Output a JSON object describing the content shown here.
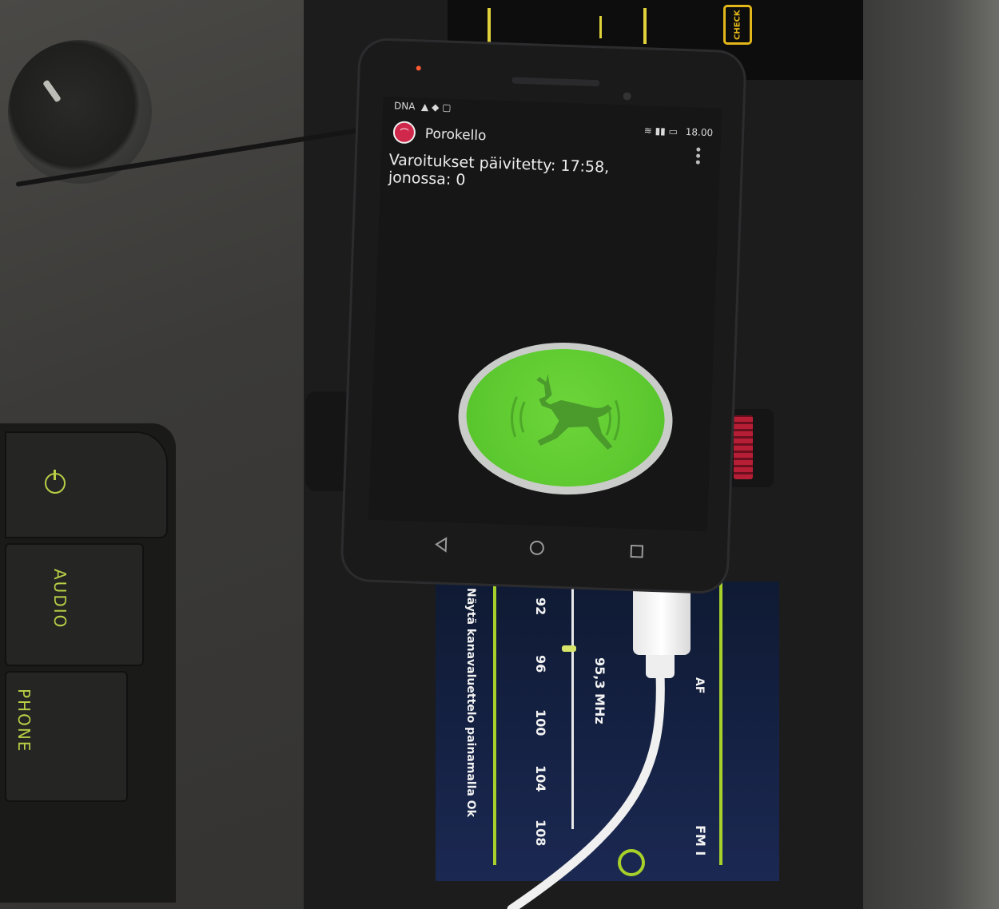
{
  "phone": {
    "status": {
      "carrier": "DNA",
      "clock": "18.00"
    },
    "app": {
      "title": "Porokello",
      "message_line1": "Varoitukset päivitetty: 17:58,",
      "message_line2": "jonossa: 0"
    },
    "alert_button": {
      "color": "#5ccb30",
      "icon": "reindeer-icon"
    },
    "nav": {
      "back": "◁",
      "home": "○",
      "recent": "□"
    }
  },
  "dashboard": {
    "check_label": "CHECK",
    "buttons": [
      {
        "label": "AUDIO"
      },
      {
        "label": "PHONE"
      }
    ]
  },
  "radio": {
    "hint": "Näytä kanavaluettelo painamalla Ok",
    "frequency": "95,3 MHz",
    "scale": [
      "92",
      "96",
      "100",
      "104",
      "108"
    ],
    "band": "FM I",
    "af": "AF"
  }
}
